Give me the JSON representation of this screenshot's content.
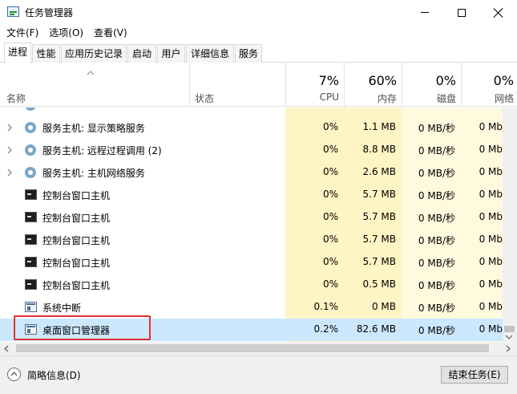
{
  "window": {
    "title": "任务管理器"
  },
  "menu": [
    "文件(F)",
    "选项(O)",
    "查看(V)"
  ],
  "tabs": [
    "进程",
    "性能",
    "应用历史记录",
    "启动",
    "用户",
    "详细信息",
    "服务"
  ],
  "active_tab": "进程",
  "columns": {
    "name": "名称",
    "status": "状态",
    "cpu": {
      "percent": "7%",
      "label": "CPU"
    },
    "memory": {
      "percent": "60%",
      "label": "内存"
    },
    "disk": {
      "percent": "0%",
      "label": "磁盘"
    },
    "network": {
      "percent": "0%",
      "label": "网络"
    }
  },
  "rows": [
    {
      "name": "服务主机: 显示策略服务",
      "cpu": "0%",
      "memory": "1.1 MB",
      "disk": "0 MB/秒",
      "network": "0 Mb",
      "icon": "gear-icon",
      "expandable": true
    },
    {
      "name": "服务主机: 远程过程调用 (2)",
      "cpu": "0%",
      "memory": "8.8 MB",
      "disk": "0 MB/秒",
      "network": "0 Mb",
      "icon": "gear-icon",
      "expandable": true
    },
    {
      "name": "服务主机: 主机网络服务",
      "cpu": "0%",
      "memory": "2.6 MB",
      "disk": "0 MB/秒",
      "network": "0 Mb",
      "icon": "gear-icon",
      "expandable": true
    },
    {
      "name": "控制台窗口主机",
      "cpu": "0%",
      "memory": "5.7 MB",
      "disk": "0 MB/秒",
      "network": "0 Mb",
      "icon": "console-icon",
      "expandable": false
    },
    {
      "name": "控制台窗口主机",
      "cpu": "0%",
      "memory": "5.7 MB",
      "disk": "0 MB/秒",
      "network": "0 Mb",
      "icon": "console-icon",
      "expandable": false
    },
    {
      "name": "控制台窗口主机",
      "cpu": "0%",
      "memory": "5.7 MB",
      "disk": "0 MB/秒",
      "network": "0 Mb",
      "icon": "console-icon",
      "expandable": false
    },
    {
      "name": "控制台窗口主机",
      "cpu": "0%",
      "memory": "5.7 MB",
      "disk": "0 MB/秒",
      "network": "0 Mb",
      "icon": "console-icon",
      "expandable": false
    },
    {
      "name": "控制台窗口主机",
      "cpu": "0%",
      "memory": "0.5 MB",
      "disk": "0 MB/秒",
      "network": "0 Mb",
      "icon": "console-icon",
      "expandable": false
    },
    {
      "name": "系统中断",
      "cpu": "0.1%",
      "memory": "0 MB",
      "disk": "0 MB/秒",
      "network": "0 Mb",
      "icon": "window-icon",
      "expandable": false
    },
    {
      "name": "桌面窗口管理器",
      "cpu": "0.2%",
      "memory": "82.6 MB",
      "disk": "0 MB/秒",
      "network": "0 Mb",
      "icon": "window-icon",
      "expandable": false,
      "selected": true
    }
  ],
  "footer": {
    "fewer_details": "简略信息(D)",
    "end_task": "结束任务(E)"
  },
  "colors": {
    "column_highlight": "#fff4c4",
    "selected_row": "#cce8ff",
    "annotation_box": "#e0312c"
  }
}
